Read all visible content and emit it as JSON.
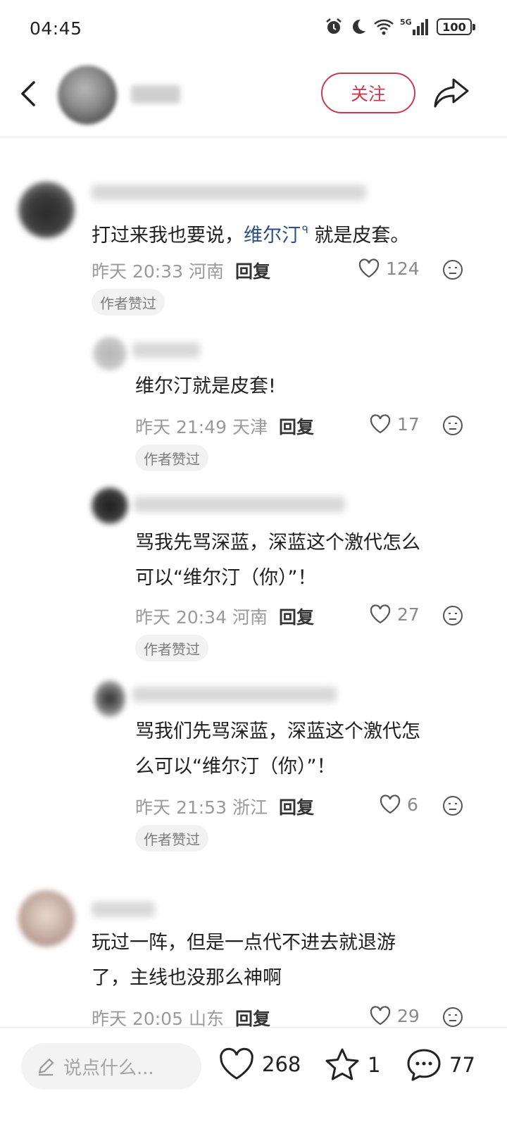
{
  "status": {
    "time": "04:45",
    "battery": "100",
    "network": "5G"
  },
  "header": {
    "follow_label": "关注"
  },
  "comments": [
    {
      "text_plain": "打过来我也要说，",
      "text_link": "维尔汀",
      "text_after": "就是皮套。",
      "meta": "昨天 20:33 河南",
      "reply_label": "回复",
      "likes": "124",
      "badge": "作者赞过"
    },
    {
      "text": "维尔汀就是皮套!",
      "meta": "昨天 21:49 天津",
      "reply_label": "回复",
      "likes": "17",
      "badge": "作者赞过"
    },
    {
      "text_line1": "骂我先骂深蓝，深蓝这个激代怎么",
      "text_line2": "可以“维尔汀（你）”！",
      "meta": "昨天 20:34 河南",
      "reply_label": "回复",
      "likes": "27",
      "badge": "作者赞过"
    },
    {
      "text_line1": "骂我们先骂深蓝，深蓝这个激代怎",
      "text_line2": "么可以“维尔汀（你）”！",
      "meta": "昨天 21:53 浙江",
      "reply_label": "回复",
      "likes": "6",
      "badge": "作者赞过"
    },
    {
      "text_line1": "玩过一阵，但是一点代不进去就退游",
      "text_line2": "了，主线也没那么神啊",
      "meta": "昨天 20:05 山东",
      "reply_label": "回复",
      "likes": "29"
    }
  ],
  "bottom": {
    "input_placeholder": "说点什么...",
    "likes": "268",
    "favorites": "1",
    "comments": "77"
  },
  "colors": {
    "accent": "#c93a4e",
    "link": "#2b4f86",
    "muted": "#9a9a9a"
  }
}
